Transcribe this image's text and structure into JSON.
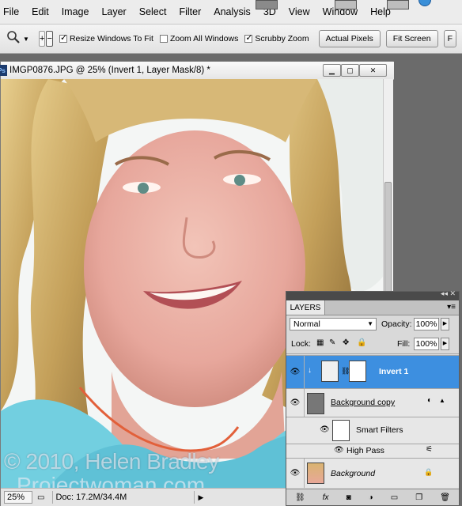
{
  "menubar": {
    "items": [
      "File",
      "Edit",
      "Image",
      "Layer",
      "Select",
      "Filter",
      "Analysis",
      "3D",
      "View",
      "Window",
      "Help"
    ]
  },
  "options": {
    "zoom_dropdown_icon": "magnifier-icon",
    "resize_windows_label": "Resize Windows To Fit",
    "zoom_all_label": "Zoom All Windows",
    "scrubby_label": "Scrubby Zoom",
    "actual_pixels_label": "Actual Pixels",
    "fit_screen_label": "Fit Screen",
    "resize_checked": true,
    "zoom_all_checked": false,
    "scrubby_checked": true
  },
  "document": {
    "title": "IMGP0876.JPG @ 25% (Invert 1, Layer Mask/8) *",
    "watermark_line1": "© 2010, Helen Bradley",
    "watermark_line2": "Projectwoman.com"
  },
  "status": {
    "zoom": "25%",
    "doc_info": "Doc: 17.2M/34.4M"
  },
  "layers_panel": {
    "tab_label": "LAYERS",
    "blend_mode": "Normal",
    "opacity_label": "Opacity:",
    "opacity_value": "100%",
    "lock_label": "Lock:",
    "fill_label": "Fill:",
    "fill_value": "100%",
    "layers": [
      {
        "name": "Invert 1",
        "selected": true
      },
      {
        "name": "Background copy",
        "selected": false
      },
      {
        "name": "Smart Filters",
        "selected": false
      },
      {
        "name": "High Pass",
        "selected": false
      },
      {
        "name": "Background",
        "selected": false
      }
    ]
  },
  "colors": {
    "selected_layer": "#3d8fe0",
    "menubar": "#ececec",
    "workspace": "#6b6b6b"
  }
}
